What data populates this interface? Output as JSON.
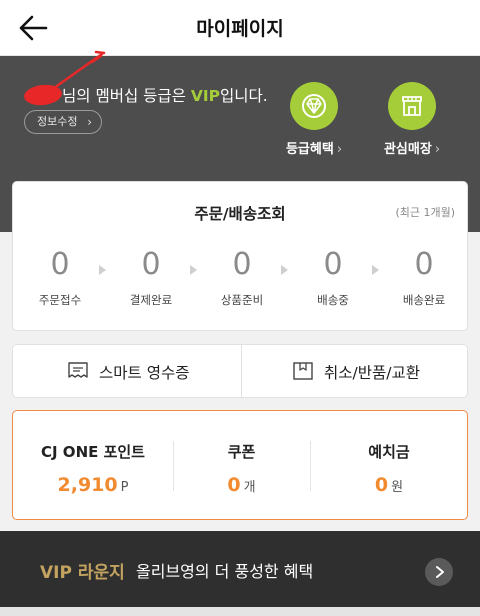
{
  "header": {
    "title": "마이페이지"
  },
  "membership": {
    "grade_prefix": "님의 멤버십 등급은 ",
    "grade": "VIP",
    "grade_suffix": "입니다.",
    "edit_label": "정보수정",
    "quick_links": [
      {
        "label": "등급혜택",
        "icon": "diamond-icon"
      },
      {
        "label": "관심매장",
        "icon": "store-icon"
      }
    ],
    "accent_color": "#a5cd39"
  },
  "orders": {
    "title": "주문/배송조회",
    "period": "(최근 1개월)",
    "steps": [
      {
        "count": "0",
        "label": "주문접수"
      },
      {
        "count": "0",
        "label": "결제완료"
      },
      {
        "count": "0",
        "label": "상품준비"
      },
      {
        "count": "0",
        "label": "배송중"
      },
      {
        "count": "0",
        "label": "배송완료"
      }
    ]
  },
  "actions": {
    "receipt": {
      "label": "스마트 영수증",
      "icon": "receipt-icon"
    },
    "cancel": {
      "label": "취소/반품/교환",
      "icon": "box-icon"
    }
  },
  "points": [
    {
      "title": "CJ ONE 포인트",
      "value": "2,910",
      "unit": "P"
    },
    {
      "title": "쿠폰",
      "value": "0",
      "unit": "개"
    },
    {
      "title": "예치금",
      "value": "0",
      "unit": "원"
    }
  ],
  "lounge": {
    "badge": "VIP 라운지",
    "text": "올리브영의 더 풍성한 혜택"
  },
  "colors": {
    "points_accent": "#f28a30",
    "card_border_highlight": "#f08a45",
    "lounge_badge": "#c3a35f"
  }
}
